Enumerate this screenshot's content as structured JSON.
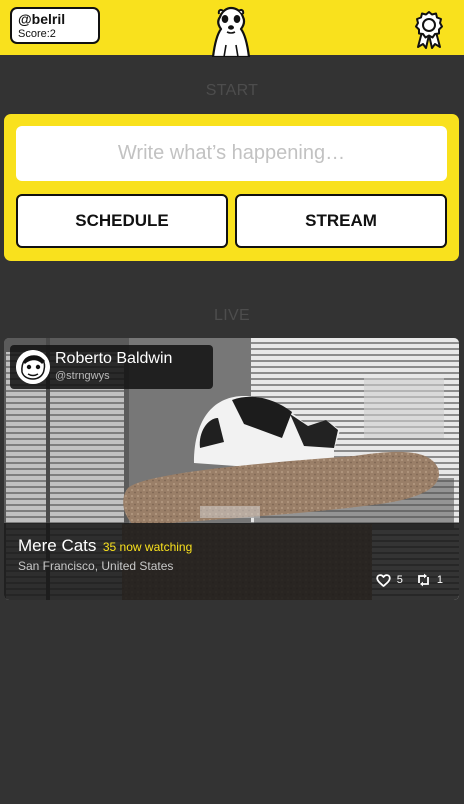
{
  "user": {
    "handle": "@belril",
    "score_text": "Score:2"
  },
  "sections": {
    "start_label": "START",
    "live_label": "LIVE"
  },
  "compose": {
    "placeholder": "Write what’s happening…",
    "value": ""
  },
  "actions": {
    "schedule_label": "SCHEDULE",
    "stream_label": "STREAM"
  },
  "live_stream": {
    "broadcaster_name": "Roberto Baldwin",
    "broadcaster_handle": "@strngwys",
    "title": "Mere Cats",
    "watching_text": "35 now watching",
    "location": "San Francisco, United States",
    "likes": "5",
    "restreams": "1"
  },
  "icons": {
    "logo": "meerkat-logo-icon",
    "achievements": "award-ribbon-icon",
    "likes": "heart-icon",
    "restreams": "restream-icon"
  },
  "colors": {
    "brand_yellow": "#f9e11d",
    "background": "#333333",
    "button_border": "#111111"
  }
}
